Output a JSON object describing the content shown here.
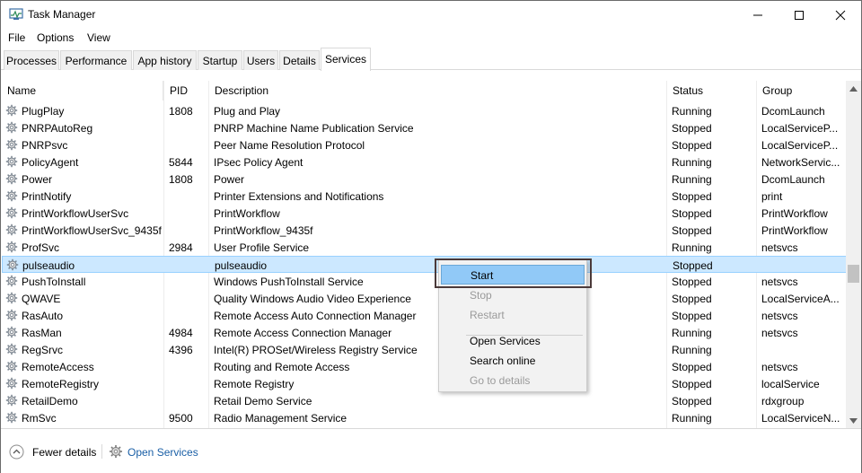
{
  "window": {
    "title": "Task Manager"
  },
  "menu": [
    "File",
    "Options",
    "View"
  ],
  "tabs": [
    "Processes",
    "Performance",
    "App history",
    "Startup",
    "Users",
    "Details",
    "Services"
  ],
  "active_tab": "Services",
  "columns": {
    "name": "Name",
    "pid": "PID",
    "description": "Description",
    "status": "Status",
    "group": "Group"
  },
  "rows": [
    {
      "name": "PlugPlay",
      "pid": "1808",
      "description": "Plug and Play",
      "status": "Running",
      "group": "DcomLaunch"
    },
    {
      "name": "PNRPAutoReg",
      "pid": "",
      "description": "PNRP Machine Name Publication Service",
      "status": "Stopped",
      "group": "LocalServiceP..."
    },
    {
      "name": "PNRPsvc",
      "pid": "",
      "description": "Peer Name Resolution Protocol",
      "status": "Stopped",
      "group": "LocalServiceP..."
    },
    {
      "name": "PolicyAgent",
      "pid": "5844",
      "description": "IPsec Policy Agent",
      "status": "Running",
      "group": "NetworkServic..."
    },
    {
      "name": "Power",
      "pid": "1808",
      "description": "Power",
      "status": "Running",
      "group": "DcomLaunch"
    },
    {
      "name": "PrintNotify",
      "pid": "",
      "description": "Printer Extensions and Notifications",
      "status": "Stopped",
      "group": "print"
    },
    {
      "name": "PrintWorkflowUserSvc",
      "pid": "",
      "description": "PrintWorkflow",
      "status": "Stopped",
      "group": "PrintWorkflow"
    },
    {
      "name": "PrintWorkflowUserSvc_9435f",
      "pid": "",
      "description": "PrintWorkflow_9435f",
      "status": "Stopped",
      "group": "PrintWorkflow"
    },
    {
      "name": "ProfSvc",
      "pid": "2984",
      "description": "User Profile Service",
      "status": "Running",
      "group": "netsvcs"
    },
    {
      "name": "pulseaudio",
      "pid": "",
      "description": "pulseaudio",
      "status": "Stopped",
      "group": "",
      "selected": true
    },
    {
      "name": "PushToInstall",
      "pid": "",
      "description": "Windows PushToInstall Service",
      "status": "Stopped",
      "group": "netsvcs"
    },
    {
      "name": "QWAVE",
      "pid": "",
      "description": "Quality Windows Audio Video Experience",
      "status": "Stopped",
      "group": "LocalServiceA..."
    },
    {
      "name": "RasAuto",
      "pid": "",
      "description": "Remote Access Auto Connection Manager",
      "status": "Stopped",
      "group": "netsvcs"
    },
    {
      "name": "RasMan",
      "pid": "4984",
      "description": "Remote Access Connection Manager",
      "status": "Running",
      "group": "netsvcs"
    },
    {
      "name": "RegSrvc",
      "pid": "4396",
      "description": "Intel(R) PROSet/Wireless Registry Service",
      "status": "Running",
      "group": ""
    },
    {
      "name": "RemoteAccess",
      "pid": "",
      "description": "Routing and Remote Access",
      "status": "Stopped",
      "group": "netsvcs"
    },
    {
      "name": "RemoteRegistry",
      "pid": "",
      "description": "Remote Registry",
      "status": "Stopped",
      "group": "localService"
    },
    {
      "name": "RetailDemo",
      "pid": "",
      "description": "Retail Demo Service",
      "status": "Stopped",
      "group": "rdxgroup"
    },
    {
      "name": "RmSvc",
      "pid": "9500",
      "description": "Radio Management Service",
      "status": "Running",
      "group": "LocalServiceN..."
    }
  ],
  "context_menu": {
    "items": [
      {
        "label": "Start",
        "enabled": true,
        "highlighted": true
      },
      {
        "label": "Stop",
        "enabled": false
      },
      {
        "label": "Restart",
        "enabled": false
      },
      {
        "label": "Open Services",
        "enabled": true
      },
      {
        "label": "Search online",
        "enabled": true
      },
      {
        "label": "Go to details",
        "enabled": false
      }
    ]
  },
  "footer": {
    "fewer_details": "Fewer details",
    "open_services": "Open Services"
  },
  "icons": {
    "app": "task-manager-icon",
    "service": "gear-icon",
    "fewer": "chevron-up-circle-icon",
    "open_services": "services-gear-icon"
  },
  "colors": {
    "selection": "#cce8ff",
    "menu_highlight": "#91c9f7",
    "link": "#1a5fa6"
  }
}
